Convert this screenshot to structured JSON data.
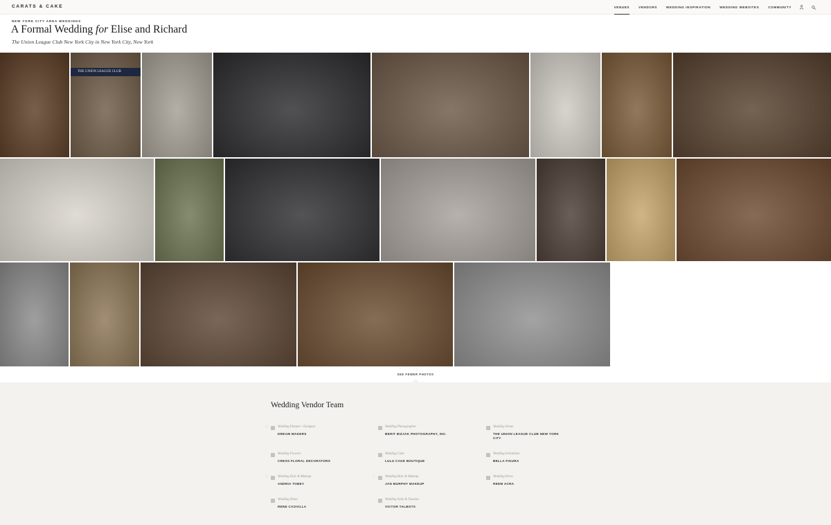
{
  "brand": {
    "logo": "CARATS & CAKE"
  },
  "nav": {
    "items": [
      "VENUES",
      "VENDORS",
      "WEDDING INSPIRATION",
      "WEDDING WEBSITES",
      "COMMUNITY"
    ],
    "icons": [
      "user-icon",
      "search-icon"
    ]
  },
  "header": {
    "eyebrow": "NEW YORK CITY AREA WEDDINGS",
    "title_prefix": "A Formal Wedding ",
    "title_for": "for",
    "title_suffix": " Elise and Richard",
    "subtitle": "The Union League Club New York City in New York City, New York"
  },
  "gallery": {
    "photo_colors": [
      "#5a3c24",
      "#6e5a45",
      "#a39d93",
      "#2b2b2d",
      "#6c5847",
      "#cfcac3",
      "#7a5a38",
      "#56402d",
      "#d9d4cc",
      "#6b7350",
      "#2e2e30",
      "#a6a09a",
      "#4a3d34",
      "#c6a56a",
      "#6d4a30",
      "#8a8a8a",
      "#8c7554",
      "#5c4535",
      "#6a4c30",
      "#8f8f8f"
    ],
    "street_sign": "THE UNION LEAGUE CLUB",
    "see_fewer": "SEE FEWER PHOTOS"
  },
  "vendors": {
    "heading": "Wedding Vendor Team",
    "items": [
      {
        "category": "Wedding Planner / Designer",
        "name": "DREAM MAKERS"
      },
      {
        "category": "Wedding Photographer",
        "name": "BERIT BIZJAK PHOTOGRAPHY, INC."
      },
      {
        "category": "Wedding Venue",
        "name": "THE UNION LEAGUE CLUB NEW YORK CITY"
      },
      {
        "category": "Wedding Flowers",
        "name": "CRESS FLORAL DECORATORS"
      },
      {
        "category": "Wedding Cake",
        "name": "LULU CAKE BOUTIQUE"
      },
      {
        "category": "Wedding Invitations",
        "name": "BELLA FIGURA"
      },
      {
        "category": "Wedding Hair & Makeup",
        "name": "ANDRIA TOBEY"
      },
      {
        "category": "Wedding Hair & Makeup",
        "name": "JAN MURPHY MAKEUP"
      },
      {
        "category": "Wedding Dress",
        "name": "REEM ACRA"
      },
      {
        "category": "Wedding Shoes",
        "name": "RENE CAOVILLA"
      },
      {
        "category": "Wedding Suits & Tuxedos",
        "name": "VICTOR TALBOTS"
      }
    ]
  }
}
